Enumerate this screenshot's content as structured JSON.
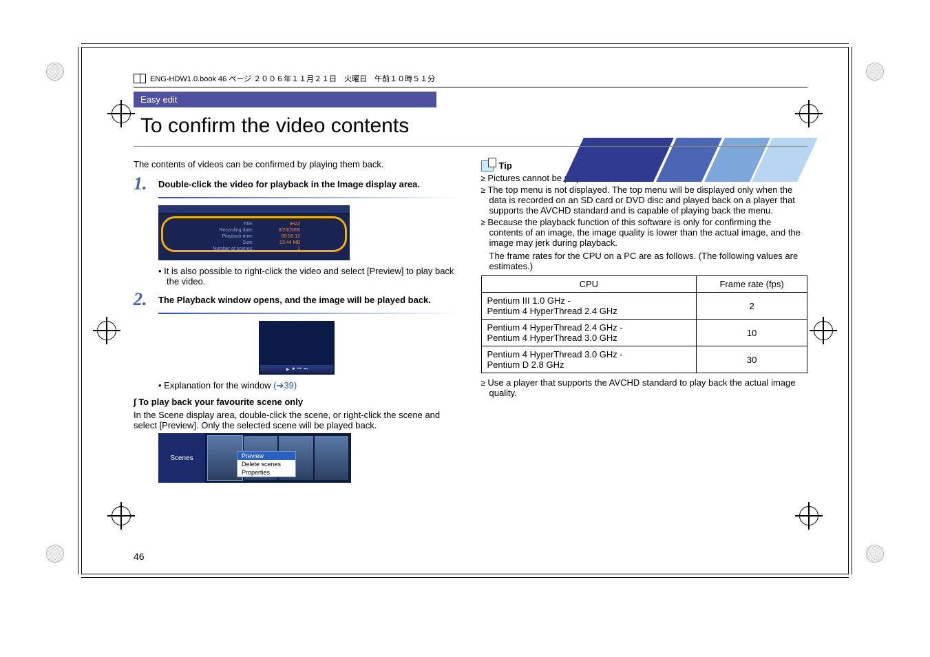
{
  "book_header": "ENG-HDW1.0.book  46 ページ  ２００６年１１月２１日　火曜日　午前１０時５１分",
  "section_bar": "Easy edit",
  "page_title": "To confirm the video contents",
  "page_number": "46",
  "left": {
    "intro": "The contents of videos can be confirmed by playing them back.",
    "steps": [
      {
        "num": "1.",
        "text": "Double-click the video for playback in the Image display area."
      },
      {
        "num": "2.",
        "text": "The Playback window opens, and the image will be played back."
      }
    ],
    "fig1": {
      "labels": {
        "title_label": "Title:",
        "title": "test2",
        "date_label": "Recording date:",
        "date": "8/20/2006",
        "pbtime_label": "Playback time:",
        "pbtime": "00:00:12",
        "size_label": "Size:",
        "size": "23.44 MB",
        "scenes_label": "Number of scenes:",
        "scenes": "1"
      }
    },
    "step1_note": "It is also possible to right-click the video and select [Preview] to play back the video.",
    "explain_prefix": "Explanation for the window ",
    "explain_link": "(➔39)",
    "favourite_heading": "To play back your favourite scene only",
    "favourite_para": "In the Scene display area, double-click the scene, or right-click the scene and select [Preview]. Only the selected scene will be played back.",
    "scene_fig": {
      "side_label": "Scenes",
      "menu": [
        "Preview",
        "Delete scenes",
        "Properties"
      ]
    }
  },
  "right": {
    "tip_label": "Tip",
    "tips": [
      "Pictures cannot be played back.",
      "The top menu is not displayed. The top menu will be displayed only when the data is recorded on an SD card or DVD disc and played back on a player that supports the AVCHD standard and is capable of playing back the menu.",
      "Because the playback function of this software is only for confirming the contents of an image, the image quality is lower than the actual image, and the image may jerk during playback."
    ],
    "frame_intro": "The frame rates for the CPU on a PC are as follows. (The following values are estimates.)",
    "table": {
      "headers": [
        "CPU",
        "Frame rate (fps)"
      ],
      "rows": [
        {
          "cpu": "Pentium III 1.0 GHz -\nPentium 4 HyperThread 2.4 GHz",
          "fps": "2"
        },
        {
          "cpu": "Pentium 4 HyperThread 2.4 GHz -\nPentium 4 HyperThread 3.0 GHz",
          "fps": "10"
        },
        {
          "cpu": "Pentium 4 HyperThread 3.0 GHz -\nPentium D 2.8 GHz",
          "fps": "30"
        }
      ]
    },
    "closing": "Use a player that supports the AVCHD standard to play back the actual image quality."
  }
}
